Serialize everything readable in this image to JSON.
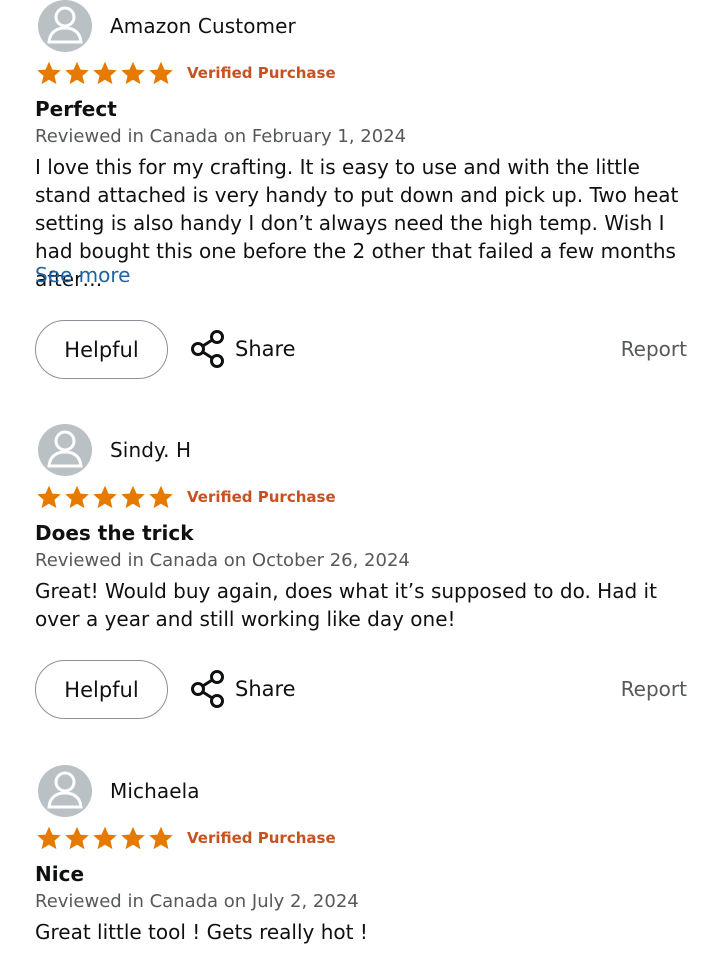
{
  "colors": {
    "star": "#e67a00",
    "verified": "#c7511f",
    "link": "#2162a1",
    "meta": "#565959",
    "avatar_bg": "#b9c1c4"
  },
  "icons": {
    "avatar": "person-icon",
    "star": "star-icon",
    "share": "share-icon"
  },
  "reviews": [
    {
      "reviewer": "Amazon Customer",
      "rating": 5,
      "verified": "Verified Purchase",
      "title": "Perfect",
      "date": "Reviewed in Canada on February 1, 2024",
      "body": "I love this for my crafting. It is easy to use and with the little stand attached is very handy to put down and pick up. Two heat setting is also handy I don’t always need the high temp. Wish I had bought this one before the 2 other that failed a few months after…",
      "see_more": "See more",
      "helpful": "Helpful",
      "share": "Share",
      "report": "Report"
    },
    {
      "reviewer": "Sindy. H",
      "rating": 5,
      "verified": "Verified Purchase",
      "title": "Does the trick",
      "date": "Reviewed in Canada on October 26, 2024",
      "body": "Great! Would buy again, does what it’s supposed to do. Had it over a year and still working like day one!",
      "helpful": "Helpful",
      "share": "Share",
      "report": "Report"
    },
    {
      "reviewer": "Michaela",
      "rating": 5,
      "verified": "Verified Purchase",
      "title": "Nice",
      "date": "Reviewed in Canada on July 2, 2024",
      "body": "Great little tool ! Gets really hot !"
    }
  ]
}
